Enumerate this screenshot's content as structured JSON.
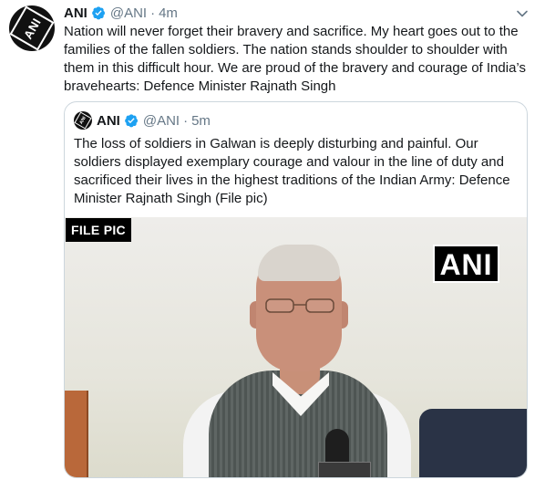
{
  "tweet": {
    "author_name": "ANI",
    "author_handle": "@ANI",
    "separator": "·",
    "time": "4m",
    "avatar_text": "ANI",
    "text": "Nation will never forget their bravery and sacrifice. My heart goes out to the families of the fallen soldiers. The nation stands shoulder to shoulder with them in this difficult hour. We are proud of the bravery and courage of India’s bravehearts: Defence Minister Rajnath Singh"
  },
  "quoted_tweet": {
    "author_name": "ANI",
    "author_handle": "@ANI",
    "separator": "·",
    "time": "5m",
    "avatar_text": "ANI",
    "text": "The loss of soldiers in Galwan is deeply disturbing and painful. Our soldiers displayed exemplary courage and valour in the line of duty and sacrificed their lives in the highest traditions of the Indian Army: Defence Minister Rajnath Singh (File pic)",
    "media": {
      "caption_badge": "FILE PIC",
      "watermark": "ANI"
    }
  },
  "icons": {
    "verified": "verified-badge-icon",
    "menu": "chevron-down-icon"
  },
  "colors": {
    "verified_blue": "#1da1f2",
    "muted_text": "#657786",
    "border": "#ccd6dd"
  }
}
